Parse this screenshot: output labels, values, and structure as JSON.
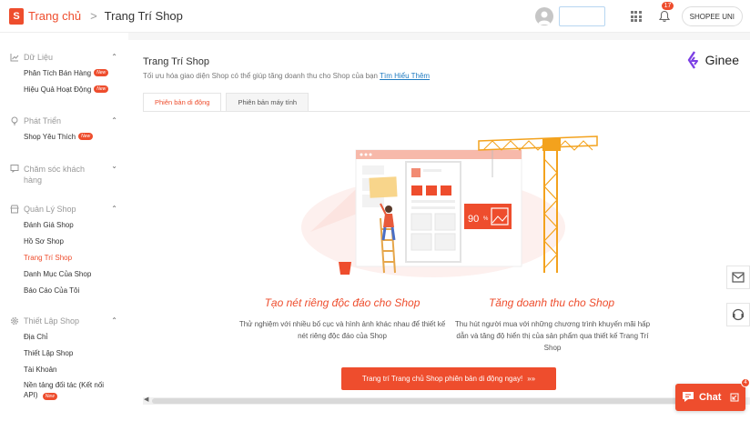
{
  "header": {
    "logo_letter": "S",
    "breadcrumb_home": "Trang chủ",
    "breadcrumb_sep": ">",
    "breadcrumb_current": "Trang Trí Shop",
    "notification_count": "17",
    "shop_name": "SHOPEE UNI"
  },
  "sidebar": {
    "new_badge": "New",
    "sections": [
      {
        "title": "Dữ Liệu",
        "icon": "chart-icon",
        "items": [
          {
            "label": "Phân Tích Bán Hàng",
            "new": true
          },
          {
            "label": "Hiệu Quả Hoạt Động",
            "new": true
          }
        ]
      },
      {
        "title": "Phát Triển",
        "icon": "lightbulb-icon",
        "items": [
          {
            "label": "Shop Yêu Thích",
            "new": true
          }
        ]
      },
      {
        "title": "Chăm sóc khách hàng",
        "icon": "chat-icon",
        "items": []
      },
      {
        "title": "Quản Lý Shop",
        "icon": "shop-icon",
        "items": [
          {
            "label": "Đánh Giá Shop"
          },
          {
            "label": "Hồ Sơ Shop"
          },
          {
            "label": "Trang Trí Shop",
            "active": true
          },
          {
            "label": "Danh Mục Của Shop"
          },
          {
            "label": "Báo Cáo Của Tôi"
          }
        ]
      },
      {
        "title": "Thiết Lập Shop",
        "icon": "gear-icon",
        "items": [
          {
            "label": "Địa Chỉ"
          },
          {
            "label": "Thiết Lập Shop"
          },
          {
            "label": "Tài Khoản"
          },
          {
            "label": "Nền tảng đối tác (Kết nối API)",
            "new": true
          }
        ]
      }
    ]
  },
  "main": {
    "title": "Trang Trí Shop",
    "subtitle": "Tối ưu hóa giao diện Shop có thể giúp tăng doanh thu cho Shop của bạn",
    "learn_more": "Tìm Hiểu Thêm",
    "brand": "Ginee",
    "tabs": [
      {
        "label": "Phiên bản di động",
        "active": true
      },
      {
        "label": "Phiên bản máy tính",
        "active": false
      }
    ],
    "illustration_discount": "90",
    "feature_left_title": "Tạo nét riêng độc đáo cho Shop",
    "feature_left_desc": "Thử nghiệm với nhiều bố cục và hình ảnh khác nhau để thiết kế nét riêng độc đáo của Shop",
    "feature_right_title": "Tăng doanh thu cho Shop",
    "feature_right_desc": "Thu hút người mua với những chương trình khuyến mãi hấp dẫn và tăng độ hiển thị của sản phẩm qua thiết kế Trang Trí Shop",
    "cta_label": "Trang trí Trang chủ Shop phiên bản di động ngay!",
    "cta_arrow": "»»"
  },
  "chat": {
    "label": "Chat",
    "badge": "4"
  },
  "colors": {
    "accent": "#ee4d2d",
    "link": "#1f7bc1"
  }
}
